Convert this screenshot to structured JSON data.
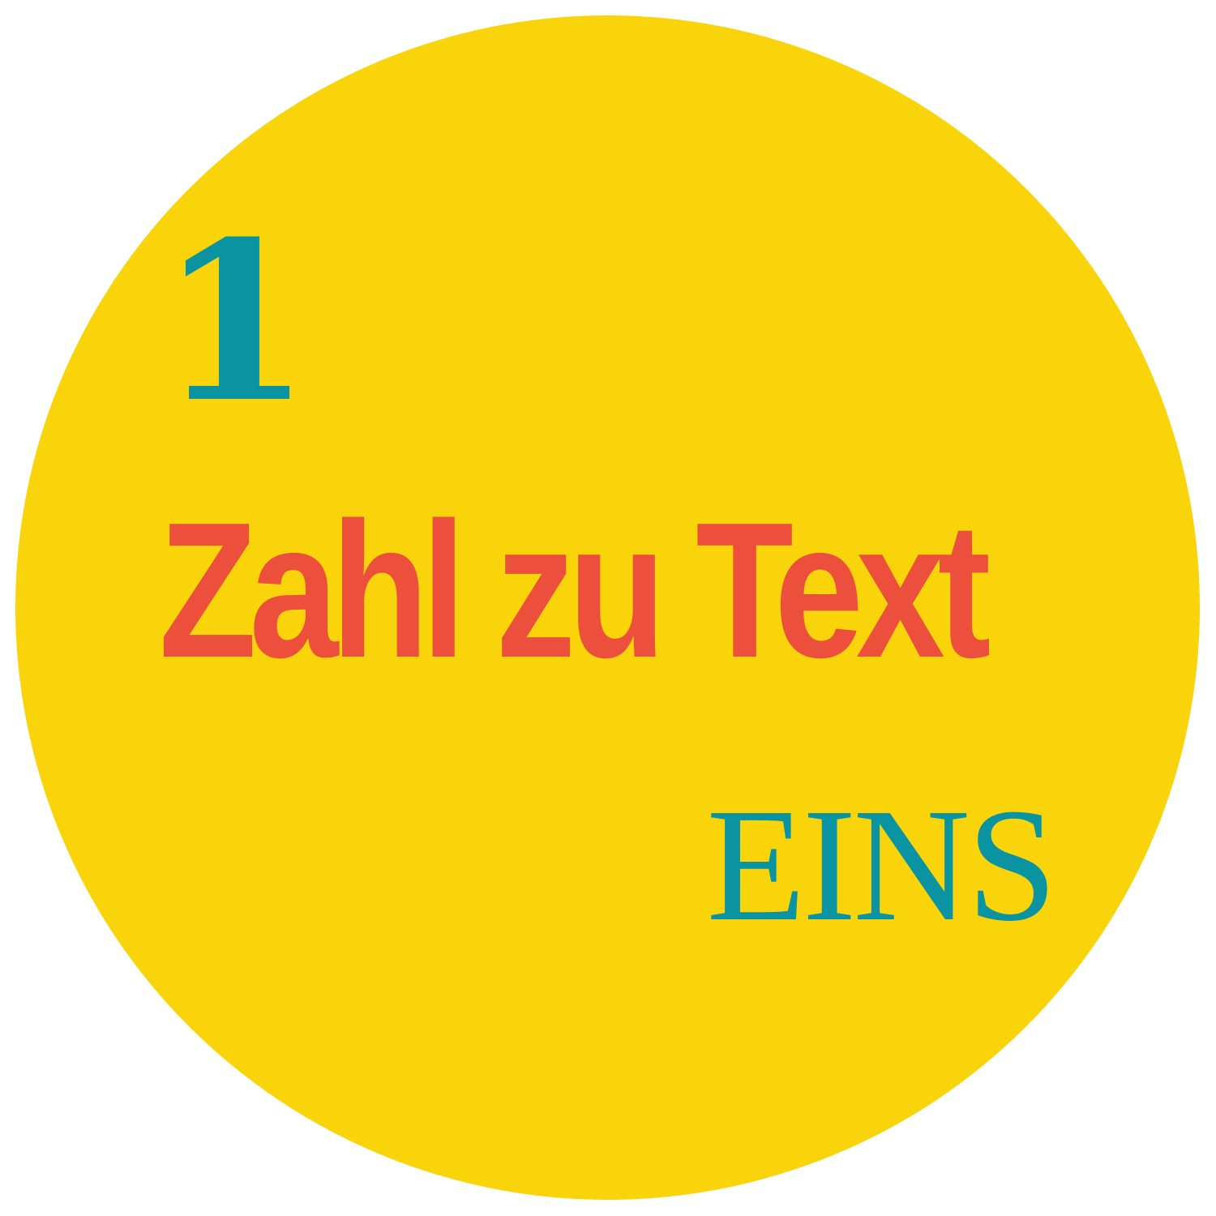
{
  "badge": {
    "numeral": "1",
    "title": "Zahl zu Text",
    "word": "EINS"
  },
  "colors": {
    "disc": "#f9d40a",
    "accent_teal": "#0a93a0",
    "accent_red": "#ec4f3b",
    "background": "#ffffff"
  }
}
